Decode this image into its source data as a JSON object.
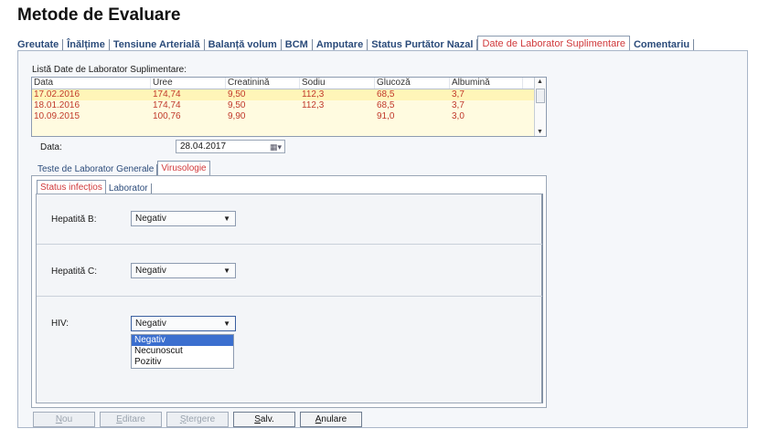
{
  "page_title": "Metode de Evaluare",
  "tabs": [
    {
      "label": "Greutate"
    },
    {
      "label": "Înălțime"
    },
    {
      "label": "Tensiune Arterială"
    },
    {
      "label": "Balanță volum"
    },
    {
      "label": "BCM"
    },
    {
      "label": "Amputare"
    },
    {
      "label": "Status Purtător Nazal"
    },
    {
      "label": "Date de Laborator Suplimentare"
    },
    {
      "label": "Comentariu"
    }
  ],
  "list_label": "Listă Date de Laborator Suplimentare:",
  "table": {
    "headers": [
      "Data",
      "Uree",
      "Creatinină",
      "Sodiu",
      "Glucoză",
      "Albumină"
    ],
    "rows": [
      [
        "17.02.2016",
        "174,74",
        "9,50",
        "112,3",
        "68,5",
        "3,7"
      ],
      [
        "18.01.2016",
        "174,74",
        "9,50",
        "112,3",
        "68,5",
        "3,7"
      ],
      [
        "10.09.2015",
        "100,76",
        "9,90",
        "",
        "91,0",
        "3,0"
      ]
    ]
  },
  "date_field": {
    "label": "Data:",
    "value": "28.04.2017"
  },
  "subtabs": [
    {
      "label": "Teste de Laborator Generale"
    },
    {
      "label": "Virusologie"
    }
  ],
  "inner_tabs": [
    {
      "label": "Status infecțios"
    },
    {
      "label": "Laborator"
    }
  ],
  "fields": {
    "hep_b": {
      "label": "Hepatită B:",
      "value": "Negativ"
    },
    "hep_c": {
      "label": "Hepatită C:",
      "value": "Negativ"
    },
    "hiv": {
      "label": "HIV:",
      "value": "Negativ"
    }
  },
  "dropdown_options": [
    "Negativ",
    "Necunoscut",
    "Pozitiv"
  ],
  "buttons": {
    "nou": {
      "first": "N",
      "rest": "ou"
    },
    "editare": {
      "first": "E",
      "rest": "ditare"
    },
    "stergere": {
      "first": "Ș",
      "rest": "tergere"
    },
    "salv": {
      "first": "S",
      "rest": "alv."
    },
    "anulare": {
      "first": "A",
      "rest": "nulare"
    }
  },
  "colors": {
    "active_tab": "#d0393b",
    "tab_text": "#2b4b7a",
    "row_bg": "#fffbe0",
    "row_text": "#c0392b",
    "selection": "#3b6fcf"
  }
}
